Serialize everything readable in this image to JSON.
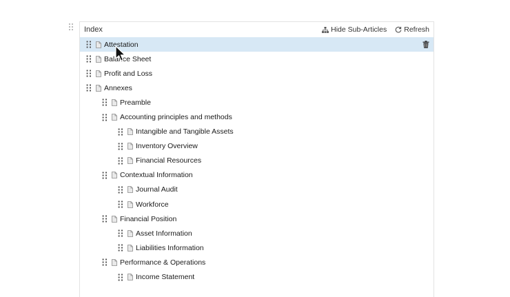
{
  "panel": {
    "title": "Index",
    "hide_sub_articles_label": "Hide Sub-Articles",
    "refresh_label": "Refresh"
  },
  "tree": [
    {
      "label": "Attestation",
      "level": 0,
      "selected": true
    },
    {
      "label": "Balance Sheet",
      "level": 0
    },
    {
      "label": "Profit and Loss",
      "level": 0
    },
    {
      "label": "Annexes",
      "level": 0
    },
    {
      "label": "Preamble",
      "level": 1
    },
    {
      "label": "Accounting principles and methods",
      "level": 1
    },
    {
      "label": "Intangible and Tangible Assets",
      "level": 2
    },
    {
      "label": "Inventory Overview",
      "level": 2
    },
    {
      "label": "Financial Resources",
      "level": 2
    },
    {
      "label": "Contextual Information",
      "level": 1
    },
    {
      "label": "Journal Audit",
      "level": 2
    },
    {
      "label": "Workforce",
      "level": 2
    },
    {
      "label": "Financial Position",
      "level": 1
    },
    {
      "label": "Asset Information",
      "level": 2
    },
    {
      "label": "Liabilities Information",
      "level": 2
    },
    {
      "label": "Performance & Operations",
      "level": 1
    },
    {
      "label": "Income Statement",
      "level": 2
    }
  ],
  "icons": {
    "grip": "drag-handle-icon",
    "document": "document-icon",
    "hierarchy": "hierarchy-icon",
    "refresh": "refresh-icon",
    "trash": "trash-icon"
  },
  "colors": {
    "selected_row": "#d7e8f5",
    "border": "#e2e2e2",
    "icon": "#666666"
  }
}
